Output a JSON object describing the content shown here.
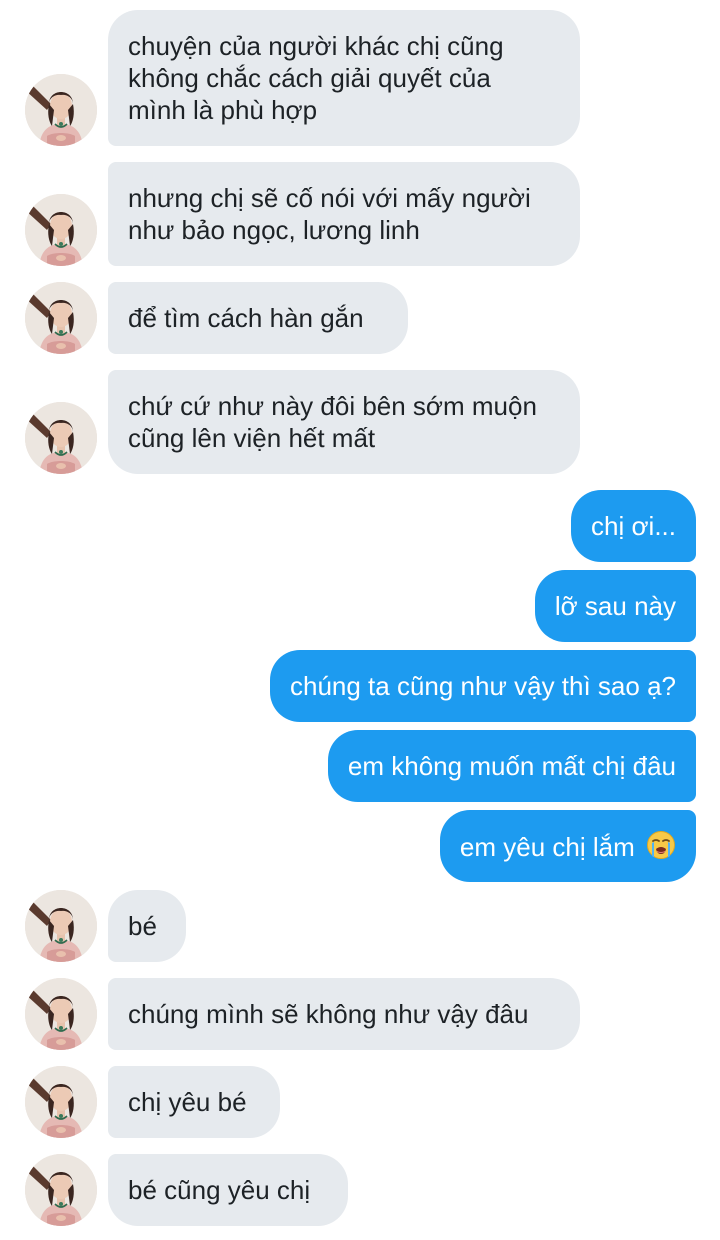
{
  "thread": {
    "incoming_top": [
      {
        "lines": [
          "chuyện của người khác chị cũng",
          "không chắc cách giải quyết của",
          "mình là phù hợp"
        ]
      },
      {
        "lines": [
          "nhưng chị sẽ cố nói với mấy người",
          "như bảo ngọc, lương linh"
        ]
      },
      {
        "lines": [
          "để tìm cách hàn gắn"
        ]
      },
      {
        "lines": [
          "chứ cứ như này đôi bên sớm muộn",
          "cũng lên viện hết mất"
        ]
      }
    ],
    "outgoing": [
      {
        "text": "chị ơi..."
      },
      {
        "text": "lỡ sau này"
      },
      {
        "text": "chúng ta cũng như vậy thì sao ạ?"
      },
      {
        "text": "em không muốn mất chị đâu"
      },
      {
        "text": "em yêu chị lắm",
        "emoji": "loudly-crying-face"
      }
    ],
    "incoming_bottom": [
      {
        "text": "bé"
      },
      {
        "text": "chúng mình sẽ không như vậy đâu"
      },
      {
        "text": "chị yêu bé"
      },
      {
        "text": "bé cũng yêu chị"
      }
    ]
  },
  "colors": {
    "incoming_bubble": "#e6eaee",
    "incoming_text": "#1d2226",
    "outgoing_bubble": "#1d9bf0",
    "outgoing_text": "#ffffff"
  }
}
